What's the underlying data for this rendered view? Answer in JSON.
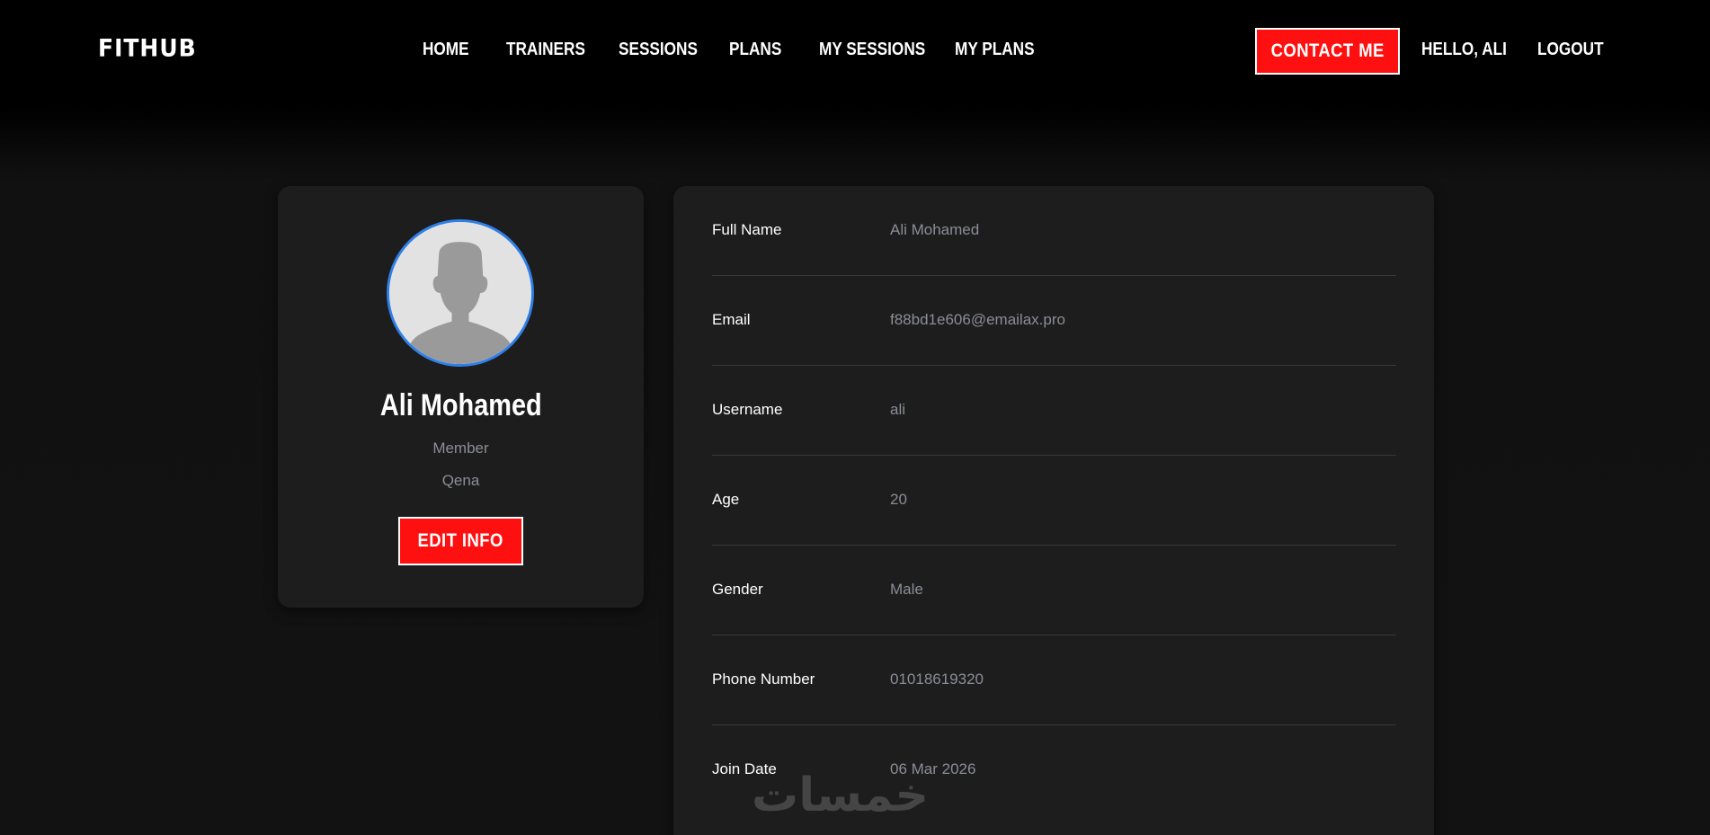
{
  "header": {
    "logo": "FITHUB",
    "nav": [
      {
        "label": "HOME"
      },
      {
        "label": "TRAINERS"
      },
      {
        "label": "SESSIONS"
      },
      {
        "label": "PLANS"
      },
      {
        "label": "MY SESSIONS"
      },
      {
        "label": "MY PLANS"
      }
    ],
    "contact_label": "CONTACT ME",
    "greeting": "HELLO, ALI",
    "logout_label": "LOGOUT"
  },
  "profile": {
    "avatar_icon": "user-avatar-icon",
    "name": "Ali Mohamed",
    "role": "Member",
    "city": "Qena",
    "edit_label": "EDIT INFO"
  },
  "details": [
    {
      "label": "Full Name",
      "value": "Ali Mohamed"
    },
    {
      "label": "Email",
      "value": "f88bd1e606@emailax.pro"
    },
    {
      "label": "Username",
      "value": "ali"
    },
    {
      "label": "Age",
      "value": "20"
    },
    {
      "label": "Gender",
      "value": "Male"
    },
    {
      "label": "Phone Number",
      "value": "01018619320"
    },
    {
      "label": "Join Date",
      "value": "06 Mar 2026"
    }
  ],
  "watermark": "خمسات",
  "colors": {
    "accent": "#ff1010",
    "avatar_border": "#2f7fe8",
    "card_bg": "#1d1d1d",
    "muted_text": "#8a8e96"
  }
}
